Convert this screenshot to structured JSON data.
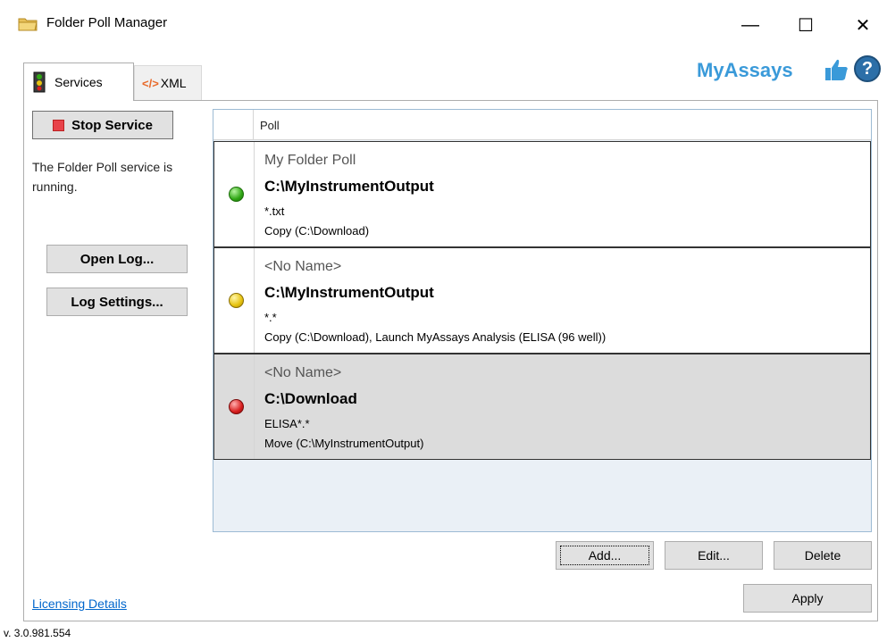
{
  "window": {
    "title": "Folder Poll Manager",
    "minimize_glyph": "—",
    "maximize_glyph": "☐",
    "close_glyph": "✕",
    "app_icon": "folder-poll-icon"
  },
  "tabs": [
    {
      "label": "Services",
      "icon": "services-icon",
      "active": true
    },
    {
      "label": "XML",
      "icon": "xml-icon",
      "active": false
    }
  ],
  "xml_glyph": "</>",
  "logo": {
    "text": "MyAssays",
    "help_glyph": "?"
  },
  "services": {
    "stop_label": "Stop Service",
    "status": "The Folder Poll service is running.",
    "open_log_label": "Open Log...",
    "log_settings_label": "Log Settings..."
  },
  "grid": {
    "column_header": "Poll",
    "rows": [
      {
        "status": "green",
        "name": "My Folder Poll",
        "folder": "C:\\MyInstrumentOutput",
        "filter": "*.txt",
        "action": "Copy (C:\\Download)",
        "selected": false
      },
      {
        "status": "yellow",
        "name": "<No Name>",
        "folder": "C:\\MyInstrumentOutput",
        "filter": "*.*",
        "action": "Copy (C:\\Download), Launch MyAssays Analysis (ELISA (96 well))",
        "selected": false
      },
      {
        "status": "red",
        "name": "<No Name>",
        "folder": "C:\\Download",
        "filter": "ELISA*.*",
        "action": "Move (C:\\MyInstrumentOutput)",
        "selected": true
      }
    ]
  },
  "buttons": {
    "add": "Add...",
    "edit": "Edit...",
    "delete": "Delete",
    "apply": "Apply"
  },
  "licensing_link": "Licensing Details",
  "version": "v. 3.0.981.554",
  "colors": {
    "accent": "#3a9ad9",
    "stop_red": "#e8434a",
    "selected_row": "#dcdcdc"
  }
}
